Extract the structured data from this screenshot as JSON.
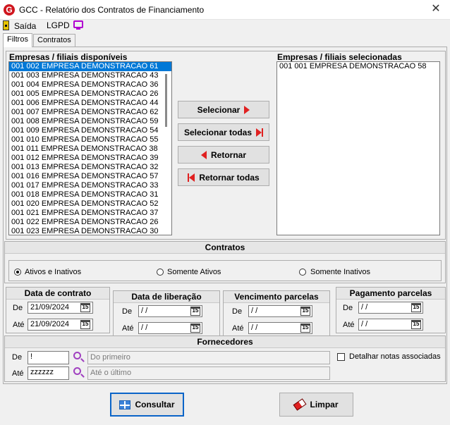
{
  "window": {
    "title": "GCC - Relatório dos Contratos de Financiamento",
    "close_glyph": "✕",
    "logo_letter": "G"
  },
  "toolbar": {
    "exit_label": "Saída",
    "lgpd_label": "LGPD"
  },
  "tabs": [
    {
      "label": "Filtros"
    },
    {
      "label": "Contratos"
    }
  ],
  "available": {
    "title": "Empresas / filiais disponíveis",
    "items": [
      "001 002 EMPRESA DEMONSTRACAO 61",
      "001 003 EMPRESA DEMONSTRACAO 43",
      "001 004 EMPRESA DEMONSTRACAO 36",
      "001 005 EMPRESA DEMONSTRACAO 26",
      "001 006 EMPRESA DEMONSTRACAO 44",
      "001 007 EMPRESA DEMONSTRACAO 62",
      "001 008 EMPRESA DEMONSTRACAO 59",
      "001 009 EMPRESA DEMONSTRACAO 54",
      "001 010 EMPRESA DEMONSTRACAO 55",
      "001 011 EMPRESA DEMONSTRACAO 38",
      "001 012 EMPRESA DEMONSTRACAO 39",
      "001 013 EMPRESA DEMONSTRACAO 32",
      "001 016 EMPRESA DEMONSTRACAO 57",
      "001 017 EMPRESA DEMONSTRACAO 33",
      "001 018 EMPRESA DEMONSTRACAO 31",
      "001 020 EMPRESA DEMONSTRACAO 52",
      "001 021 EMPRESA DEMONSTRACAO 37",
      "001 022 EMPRESA DEMONSTRACAO 26",
      "001 023 EMPRESA DEMONSTRACAO 30"
    ]
  },
  "selected": {
    "title": "Empresas / filiais selecionadas",
    "items": [
      "001 001 EMPRESA DEMONSTRACAO 58"
    ]
  },
  "buttons": {
    "select": "Selecionar",
    "select_all": "Selecionar todas",
    "back": "Retornar",
    "back_all": "Retornar todas"
  },
  "contratos": {
    "title": "Contratos",
    "options": [
      "Ativos e Inativos",
      "Somente Ativos",
      "Somente Inativos"
    ],
    "selected": "Ativos e Inativos"
  },
  "dates": {
    "contrato": {
      "title": "Data de contrato",
      "de_label": "De",
      "ate_label": "Até",
      "de": "21/09/2024",
      "ate": "21/09/2024"
    },
    "liberacao": {
      "title": "Data de liberação",
      "de_label": "De",
      "ate_label": "Até",
      "de": " / /",
      "ate": " / /"
    },
    "vencimento": {
      "title": "Vencimento parcelas",
      "de_label": "De",
      "ate_label": "Até",
      "de": " / /",
      "ate": " / /"
    },
    "pagamento": {
      "title": "Pagamento parcelas",
      "de_label": "De",
      "ate_label": "Até",
      "de": " / /",
      "ate": " / /"
    },
    "cal_glyph": "15"
  },
  "fornecedores": {
    "title": "Fornecedores",
    "de_label": "De",
    "ate_label": "Até",
    "de_value": "!",
    "ate_value": "zzzzzz",
    "de_desc": "Do primeiro",
    "ate_desc": "Até o último",
    "detail_label": "Detalhar notas associadas"
  },
  "footer": {
    "consultar": "Consultar",
    "limpar": "Limpar"
  }
}
